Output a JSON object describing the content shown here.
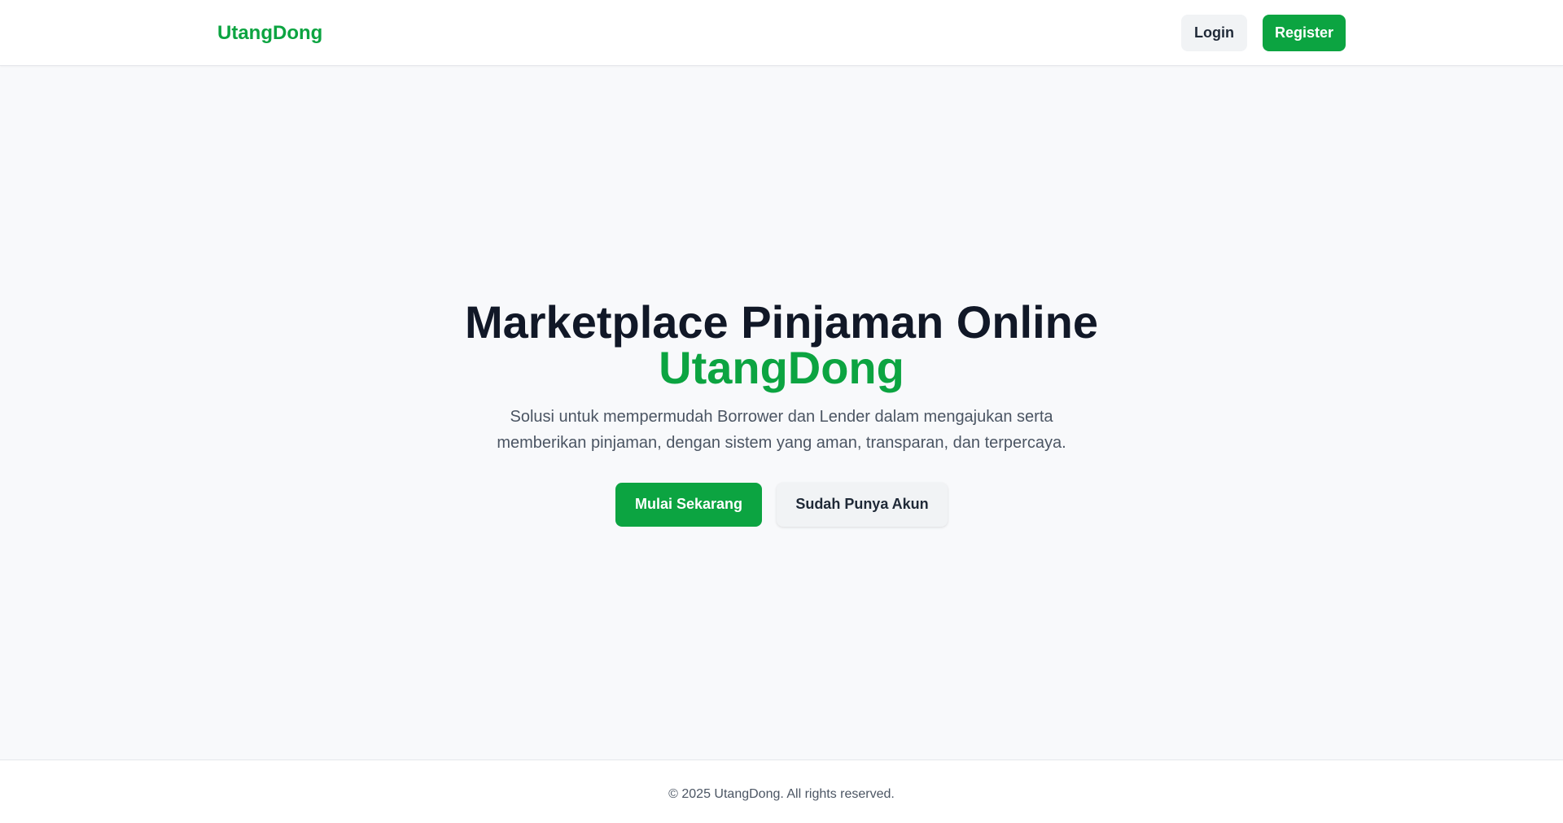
{
  "header": {
    "brand": "UtangDong",
    "login_label": "Login",
    "register_label": "Register"
  },
  "hero": {
    "title_line1": "Marketplace Pinjaman Online",
    "title_line2": "UtangDong",
    "description": "Solusi untuk mempermudah Borrower dan Lender dalam mengajukan serta memberikan pinjaman, dengan sistem yang aman, transparan, dan terpercaya.",
    "primary_button": "Mulai Sekarang",
    "secondary_button": "Sudah Punya Akun"
  },
  "footer": {
    "copyright": "© 2025 UtangDong. All rights reserved."
  },
  "colors": {
    "brand_green": "#0ca441",
    "heading": "#111827",
    "body_text": "#4b5563",
    "page_background": "#f8f9fb"
  }
}
